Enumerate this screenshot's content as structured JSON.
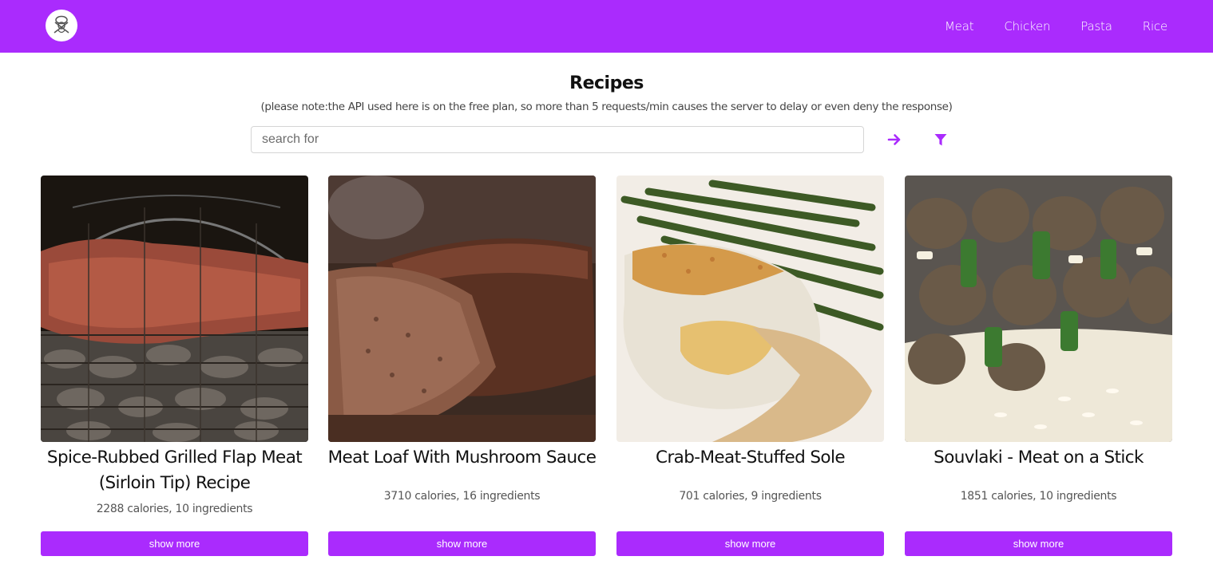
{
  "nav": {
    "logo_icon": "chef-icon",
    "links": [
      "Meat",
      "Chicken",
      "Pasta",
      "Rice"
    ]
  },
  "main": {
    "title": "Recipes",
    "note": "(please note:the API used here is on the free plan, so more than 5 requests/min causes the server to delay or even deny the response)",
    "search": {
      "placeholder": "search for",
      "value": "",
      "submit_icon": "arrow-right-icon",
      "filter_icon": "filter-icon"
    }
  },
  "recipes": [
    {
      "title": "Spice-Rubbed Grilled Flap Meat (Sirloin Tip) Recipe",
      "info": "2288 calories, 10 ingredients",
      "button": "show more"
    },
    {
      "title": "Meat Loaf With Mushroom Sauce",
      "info": "3710 calories, 16 ingredients",
      "button": "show more"
    },
    {
      "title": "Crab-Meat-Stuffed Sole",
      "info": "701 calories, 9 ingredients",
      "button": "show more"
    },
    {
      "title": "Souvlaki - Meat on a Stick",
      "info": "1851 calories, 10 ingredients",
      "button": "show more"
    }
  ],
  "colors": {
    "brand": "#aa2bfd",
    "nav_text": "#ffffff",
    "button_text": "#ffffff"
  }
}
